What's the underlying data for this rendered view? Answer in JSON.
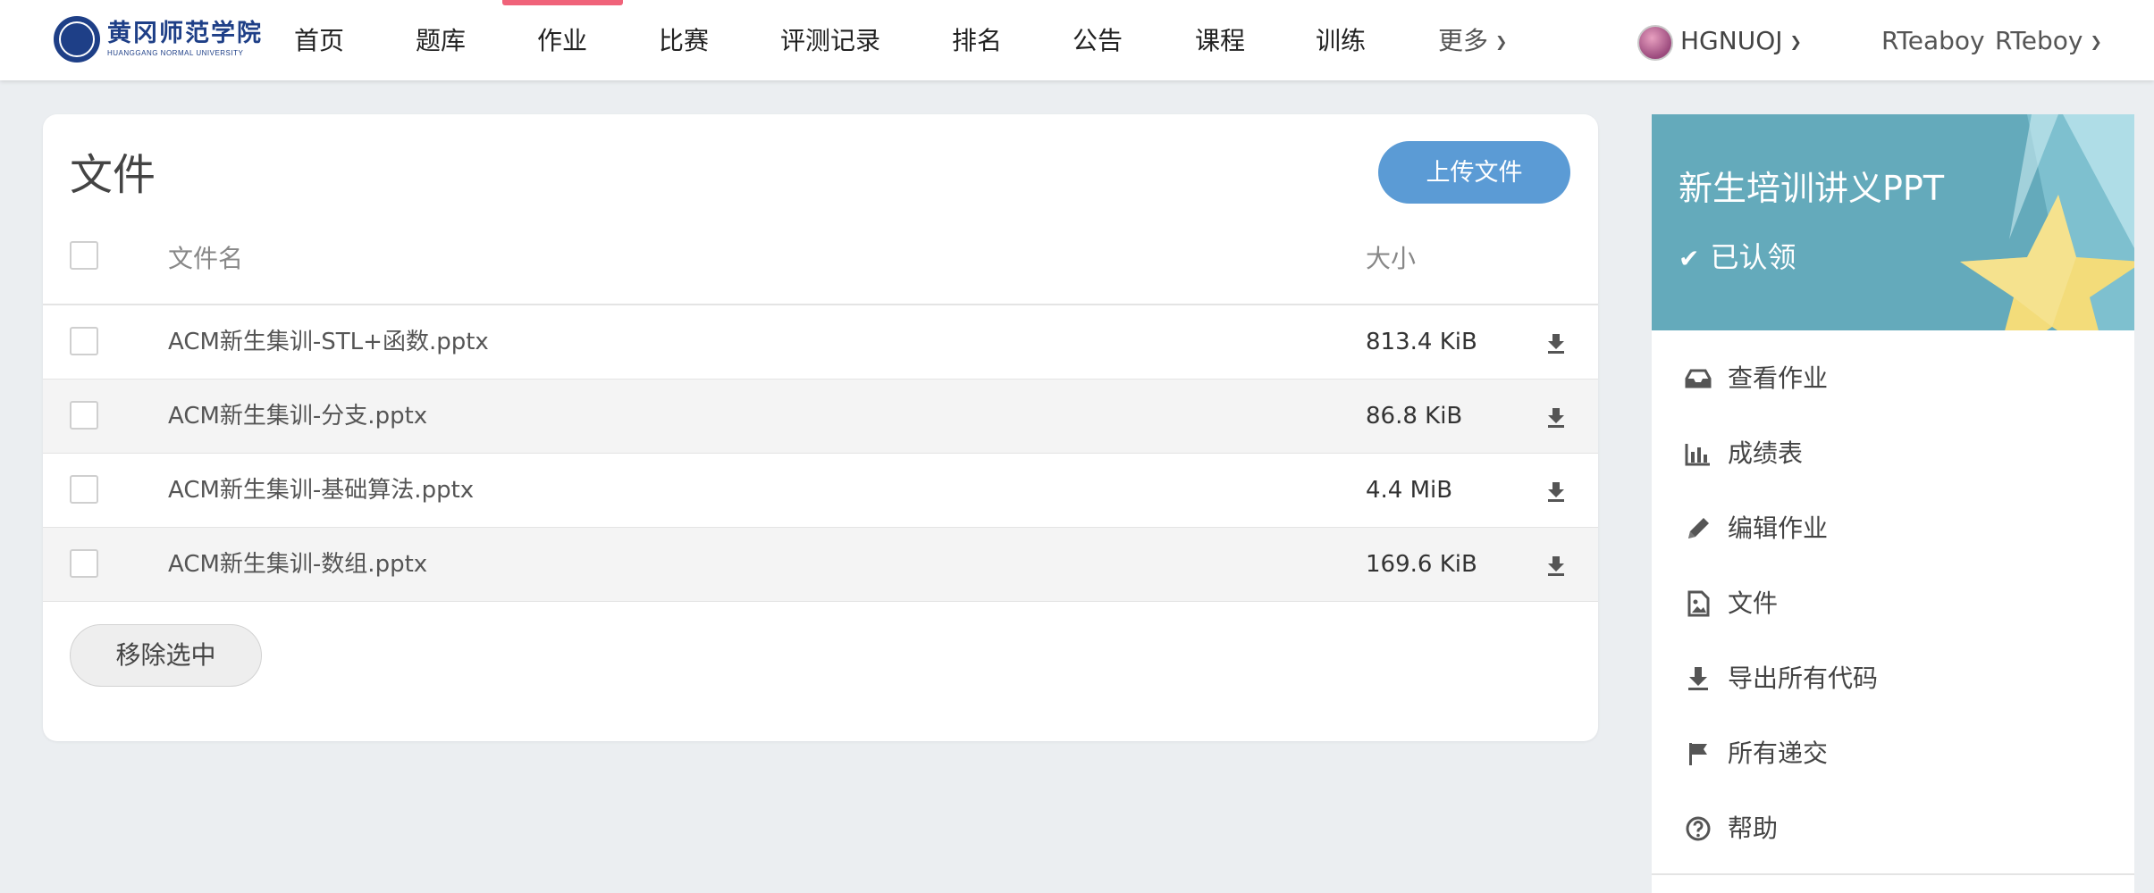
{
  "logo": {
    "name_cn": "黄冈师范学院",
    "name_en": "HUANGGANG NORMAL UNIVERSITY"
  },
  "nav": {
    "items": [
      "首页",
      "题库",
      "作业",
      "比赛",
      "评测记录",
      "排名",
      "公告",
      "课程",
      "训练"
    ],
    "more": "更多",
    "active": "作业",
    "domain": "HGNUOJ",
    "user_name": "RTeaboy",
    "user_menu": "RTeboy"
  },
  "files": {
    "title": "文件",
    "upload_label": "上传文件",
    "columns": {
      "name": "文件名",
      "size": "大小"
    },
    "rows": [
      {
        "name": "ACM新生集训-STL+函数.pptx",
        "size": "813.4 KiB"
      },
      {
        "name": "ACM新生集训-分支.pptx",
        "size": "86.8 KiB"
      },
      {
        "name": "ACM新生集训-基础算法.pptx",
        "size": "4.4 MiB"
      },
      {
        "name": "ACM新生集训-数组.pptx",
        "size": "169.6 KiB"
      }
    ],
    "remove_label": "移除选中"
  },
  "sidebar": {
    "title": "新生培训讲义PPT",
    "status": "已认领",
    "items": [
      {
        "label": "查看作业",
        "icon": "inbox-icon"
      },
      {
        "label": "成绩表",
        "icon": "bar-chart-icon"
      },
      {
        "label": "编辑作业",
        "icon": "pencil-icon"
      },
      {
        "label": "文件",
        "icon": "file-image-icon"
      },
      {
        "label": "导出所有代码",
        "icon": "download-icon"
      },
      {
        "label": "所有递交",
        "icon": "flag-icon"
      },
      {
        "label": "帮助",
        "icon": "help-circle-icon"
      }
    ]
  },
  "colors": {
    "accent_nav": "#f0637a",
    "primary_button": "#5b9bd5",
    "banner": "#64aabb",
    "star": "#f3dc7a",
    "page_bg": "#ebeef1"
  }
}
